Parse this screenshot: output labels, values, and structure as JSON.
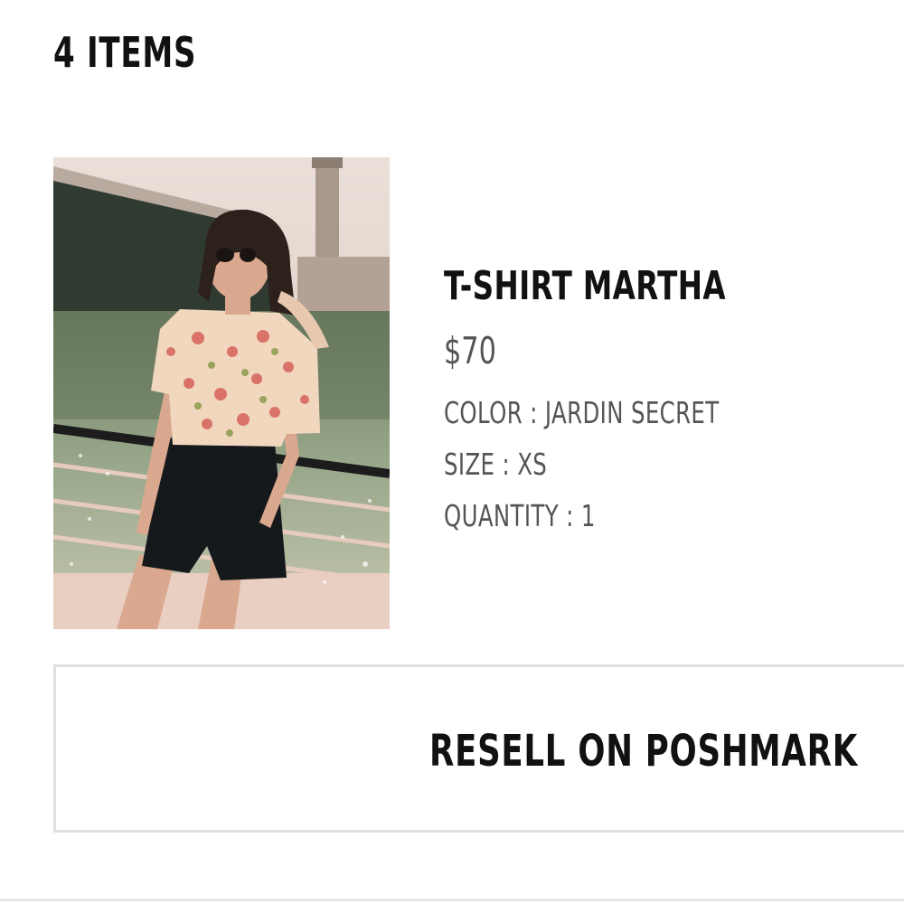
{
  "cart": {
    "items_count_label": "4 ITEMS"
  },
  "item": {
    "name": "T-SHIRT MARTHA",
    "price": "$70",
    "color_line": "COLOR : JARDIN SECRET",
    "size_line": "SIZE : XS",
    "quantity_line": "QUANTITY : 1",
    "image_icon": "product-photo"
  },
  "actions": {
    "resell_label": "RESELL ON POSHMARK"
  },
  "colors": {
    "text_primary": "#111111",
    "text_secondary": "#555555",
    "border": "#e0e0e0"
  }
}
